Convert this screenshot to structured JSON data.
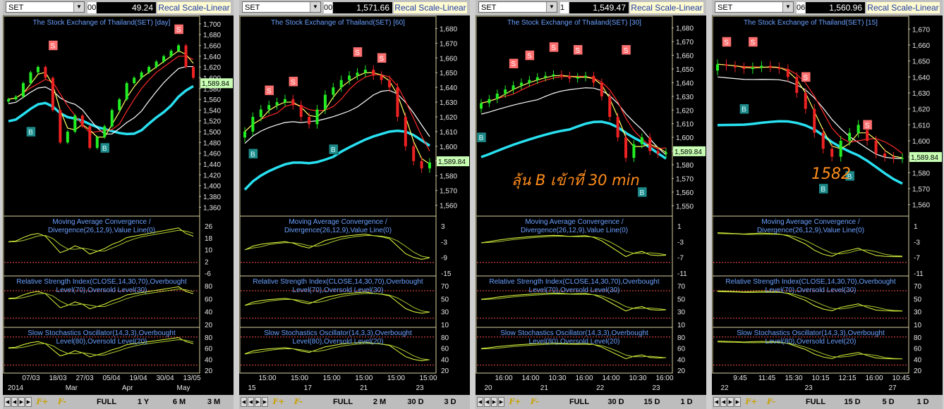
{
  "colors": {
    "bg": "#000000",
    "price_hl": "#c8ffb4",
    "fast_ma": "#ffff66",
    "mid_ma": "#ff2a2a",
    "slow_ma": "#ffffff",
    "trend_ma": "#28e0f0",
    "up": "#22ee22",
    "down": "#ee2222",
    "sig_s": "#ff7070",
    "sig_s_strong": "#e01010",
    "sig_b": "#1e8a8a",
    "sig_b_light": "#7cdc1a",
    "grid_label": "#6aa0ff",
    "frame": "#d8d0a0",
    "ref_line": "#ff5050",
    "note": "#ff8c1a"
  },
  "footer_labels": {
    "full": "FULL",
    "f_plus": "F+",
    "f_minus": "F-"
  },
  "indicator_titles": {
    "macd": "Moving Average Convergence / Divergence(26,12,9),Value Line(0)",
    "rsi": "Relative Strength Index(CLOSE,14,30,70),Overbought Level(70),Oversold Level(30)",
    "stoch": "Slow Stochastics Oscillator(14,3,3),Overbought Level(80),Oversold Level(20)"
  },
  "notes": {
    "panel3": "ลุ้น B เข้าที่ 30 min",
    "panel4": "1582"
  },
  "chart_data": [
    {
      "type": "line",
      "symbol": "SET",
      "price_fragment": "00",
      "price": "49.24",
      "scale_button": "Recal Scale-Linear",
      "title": "The Stock Exchange of Thailand(SET) [day]",
      "last_price_label": "1,589.84",
      "y_ticks": [
        "1,700",
        "1,680",
        "1,660",
        "1,640",
        "1,620",
        "1,600",
        "1,580",
        "1,560",
        "1,540",
        "1,520",
        "1,500",
        "1,480",
        "1,460",
        "1,440",
        "1,420",
        "1,400",
        "1,380",
        "1,360"
      ],
      "ylim": [
        1350,
        1705
      ],
      "close": [
        1560,
        1565,
        1590,
        1610,
        1620,
        1600,
        1540,
        1480,
        1500,
        1530,
        1510,
        1470,
        1490,
        1510,
        1540,
        1560,
        1590,
        1600,
        1610,
        1620,
        1630,
        1640,
        1650,
        1660,
        1620,
        1600
      ],
      "macd_ticks": [
        "26",
        "18",
        "10",
        "2",
        "-6"
      ],
      "rsi_ticks": [
        "80",
        "60",
        "40",
        "20"
      ],
      "stoch_ticks": [
        "80",
        "60",
        "40",
        "20"
      ],
      "x_labels": [
        "07/03",
        "18/03",
        "27/03",
        "05/04",
        "19/04",
        "30/04",
        "13/05"
      ],
      "x_labels2": [
        "2014",
        "Mar",
        "Apr",
        "May"
      ],
      "period_buttons": [
        "1 Y",
        "6 M",
        "3 M"
      ],
      "signals": [
        {
          "t": "S",
          "i": 6,
          "v": 1660
        },
        {
          "t": "S",
          "i": 23,
          "v": 1690
        },
        {
          "t": "B",
          "i": 3,
          "v": 1500
        },
        {
          "t": "B",
          "i": 13,
          "v": 1470
        }
      ]
    },
    {
      "type": "line",
      "symbol": "SET",
      "price_fragment": "00",
      "price": "1,571.66",
      "scale_button": "Recal Scale-Linear",
      "title": "The Stock Exchange of Thailand(SET) [60]",
      "last_price_label": "1,589.84",
      "y_ticks": [
        "1,680",
        "1,670",
        "1,660",
        "1,650",
        "1,640",
        "1,630",
        "1,620",
        "1,610",
        "1,600",
        "1,590",
        "1,580",
        "1,570",
        "1,560"
      ],
      "ylim": [
        1555,
        1685
      ],
      "close": [
        1610,
        1620,
        1625,
        1628,
        1630,
        1632,
        1628,
        1620,
        1615,
        1625,
        1635,
        1640,
        1645,
        1648,
        1650,
        1652,
        1648,
        1645,
        1640,
        1620,
        1600,
        1590,
        1585,
        1589
      ],
      "macd_ticks": [
        "3",
        "-3",
        "-9",
        "-15"
      ],
      "rsi_ticks": [
        "70",
        "50",
        "30",
        "10"
      ],
      "stoch_ticks": [
        "80",
        "60",
        "40",
        "20"
      ],
      "x_labels": [
        "15:00",
        "15:00",
        "15:00",
        "15:00",
        "15:00",
        "15:00"
      ],
      "x_labels2": [
        "15",
        "17",
        "21",
        "23"
      ],
      "period_buttons": [
        "2 M",
        "30 D",
        "3 D"
      ],
      "signals": [
        {
          "t": "S",
          "i": 3,
          "v": 1638
        },
        {
          "t": "S",
          "i": 6,
          "v": 1644
        },
        {
          "t": "S",
          "i": 14,
          "v": 1664
        },
        {
          "t": "S",
          "i": 17,
          "v": 1660
        },
        {
          "t": "B",
          "i": 1,
          "v": 1595
        },
        {
          "t": "B",
          "i": 11,
          "v": 1598
        }
      ]
    },
    {
      "type": "line",
      "symbol": "SET",
      "price_fragment": "1",
      "price": "1,549.47",
      "scale_button": "Recal Scale-Linear",
      "title": "The Stock Exchange of Thailand(SET) [30]",
      "last_price_label": "1,589.84",
      "y_ticks": [
        "1,680",
        "1,670",
        "1,660",
        "1,650",
        "1,640",
        "1,630",
        "1,620",
        "1,610",
        "1,600",
        "1,590",
        "1,580",
        "1,570",
        "1,560",
        "1,550"
      ],
      "ylim": [
        1545,
        1685
      ],
      "close": [
        1625,
        1628,
        1632,
        1635,
        1638,
        1640,
        1642,
        1644,
        1645,
        1646,
        1645,
        1643,
        1644,
        1645,
        1640,
        1630,
        1615,
        1600,
        1585,
        1595,
        1600,
        1590,
        1588,
        1589
      ],
      "macd_ticks": [
        "1",
        "-3",
        "-7",
        "-11"
      ],
      "rsi_ticks": [
        "70",
        "50",
        "30",
        "10"
      ],
      "stoch_ticks": [
        "80",
        "60",
        "40",
        "20"
      ],
      "x_labels": [
        "16:00",
        "14:00",
        "10:30",
        "16:00",
        "14:00",
        "10:30",
        "16:00"
      ],
      "x_labels2": [
        "20",
        "21",
        "22",
        "23"
      ],
      "period_buttons": [
        "30 D",
        "15 D",
        "1 D"
      ],
      "signals": [
        {
          "t": "S",
          "i": 4,
          "v": 1654
        },
        {
          "t": "S",
          "i": 6,
          "v": 1660
        },
        {
          "t": "S",
          "i": 9,
          "v": 1666
        },
        {
          "t": "S",
          "i": 12,
          "v": 1664
        },
        {
          "t": "S",
          "i": 18,
          "v": 1664
        },
        {
          "t": "B",
          "i": 0,
          "v": 1600
        },
        {
          "t": "B",
          "i": 20,
          "v": 1560
        }
      ]
    },
    {
      "type": "line",
      "symbol": "SET",
      "price_fragment": "06",
      "price": "1,560.96",
      "scale_button": "Recal Scale-Linear",
      "title": "The Stock Exchange of Thailand(SET) [15]",
      "last_price_label": "1,589.84",
      "y_ticks": [
        "1,670",
        "1,660",
        "1,650",
        "1,640",
        "1,630",
        "1,620",
        "1,610",
        "1,600",
        "1,590",
        "1,580",
        "1,570",
        "1,560"
      ],
      "ylim": [
        1555,
        1675
      ],
      "close": [
        1648,
        1647,
        1646,
        1645,
        1646,
        1647,
        1646,
        1645,
        1640,
        1630,
        1620,
        1605,
        1595,
        1590,
        1600,
        1605,
        1610,
        1600,
        1592,
        1590,
        1589,
        1589
      ],
      "macd_ticks": [
        "1",
        "-3",
        "-7",
        "-11"
      ],
      "rsi_ticks": [
        "70",
        "50",
        "30",
        "10"
      ],
      "stoch_ticks": [
        "80",
        "60",
        "40",
        "20"
      ],
      "x_labels": [
        "9:45",
        "11:45",
        "15:30",
        "10:15",
        "12:15",
        "16:00",
        "10:45"
      ],
      "x_labels2": [
        "22",
        "23",
        "27"
      ],
      "period_buttons": [
        "15 D",
        "5 D",
        "1 D"
      ],
      "signals": [
        {
          "t": "S",
          "i": 1,
          "v": 1662
        },
        {
          "t": "S",
          "i": 4,
          "v": 1662
        },
        {
          "t": "S",
          "i": 10,
          "v": 1640
        },
        {
          "t": "S",
          "i": 17,
          "v": 1610
        },
        {
          "t": "B",
          "i": 3,
          "v": 1620
        },
        {
          "t": "B",
          "i": 12,
          "v": 1570
        },
        {
          "t": "B",
          "i": 15,
          "v": 1578
        }
      ]
    }
  ]
}
